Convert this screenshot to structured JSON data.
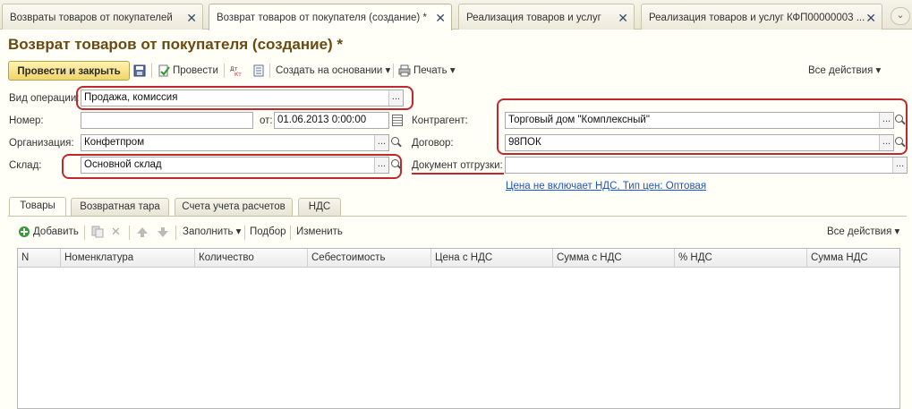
{
  "window_tabs": [
    {
      "label": "Возвраты товаров от покупателей",
      "active": false
    },
    {
      "label": "Возврат товаров от покупателя (создание) *",
      "active": true
    },
    {
      "label": "Реализация товаров и услуг",
      "active": false
    },
    {
      "label": "Реализация товаров и услуг КФП00000003 ...",
      "active": false
    }
  ],
  "title": "Возврат товаров от покупателя (создание) *",
  "toolbar": {
    "post_close": "Провести и закрыть",
    "post": "Провести",
    "create_based": "Создать на основании",
    "print": "Печать",
    "all_actions": "Все действия"
  },
  "form": {
    "operation_label": "Вид операции:",
    "operation_value": "Продажа, комиссия",
    "number_label": "Номер:",
    "number_value": "",
    "date_label": "от:",
    "date_value": "01.06.2013  0:00:00",
    "org_label": "Организация:",
    "org_value": "Конфетпром",
    "warehouse_label": "Склад:",
    "warehouse_value": "Основной склад",
    "counterparty_label": "Контрагент:",
    "counterparty_value": "Торговый дом \"Комплексный\"",
    "contract_label": "Договор:",
    "contract_value": "98ПОК",
    "shipment_doc_label": "Документ отгрузки:",
    "shipment_doc_value": "",
    "price_link": "Цена не включает НДС, Тип цен: Оптовая"
  },
  "inner_tabs": [
    "Товары",
    "Возвратная тара",
    "Счета учета расчетов",
    "НДС"
  ],
  "table_toolbar": {
    "add": "Добавить",
    "fill": "Заполнить",
    "selection": "Подбор",
    "change": "Изменить",
    "all_actions": "Все действия"
  },
  "table_columns": [
    "N",
    "Номенклатура",
    "Количество",
    "Себестоимость",
    "Цена с НДС",
    "Сумма с НДС",
    "% НДС",
    "Сумма НДС"
  ],
  "colors": {
    "title": "#6a4a10",
    "highlight": "#c0282c",
    "link": "#1a56c8",
    "main_button": "#f1d56a"
  }
}
